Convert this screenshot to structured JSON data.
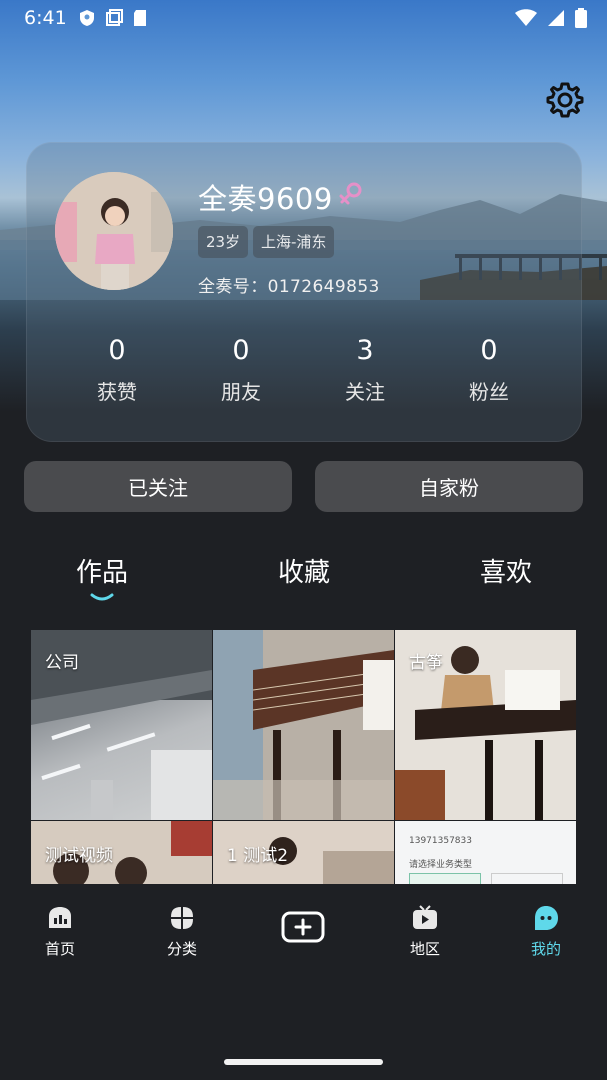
{
  "status_bar": {
    "time": "6:41"
  },
  "profile": {
    "name": "全奏9609",
    "age": "23岁",
    "location": "上海-浦东",
    "id_line": "全奏号：0172649853"
  },
  "stats": [
    {
      "value": "0",
      "label": "获赞"
    },
    {
      "value": "0",
      "label": "朋友"
    },
    {
      "value": "3",
      "label": "关注"
    },
    {
      "value": "0",
      "label": "粉丝"
    }
  ],
  "actions": {
    "follow_label": "已关注",
    "fans_label": "自家粉"
  },
  "tabs": [
    {
      "label": "作品",
      "active": true
    },
    {
      "label": "收藏"
    },
    {
      "label": "喜欢"
    }
  ],
  "videos": [
    {
      "caption": "公司"
    },
    {
      "caption": ""
    },
    {
      "caption": "古筝"
    },
    {
      "caption": "测试视频"
    },
    {
      "caption": "1 测试2"
    },
    {
      "caption": "",
      "text_lines": [
        "13971357833",
        "请选择业务类型"
      ]
    }
  ],
  "nav": [
    {
      "label": "首页",
      "icon": "home-icon"
    },
    {
      "label": "分类",
      "icon": "category-icon"
    },
    {
      "label": "",
      "icon": "add-icon"
    },
    {
      "label": "地区",
      "icon": "tv-icon"
    },
    {
      "label": "我的",
      "icon": "profile-icon",
      "active": true
    }
  ],
  "colors": {
    "accent": "#5fd8ea",
    "gender_icon": "#e690c8",
    "background": "#1e2024"
  }
}
